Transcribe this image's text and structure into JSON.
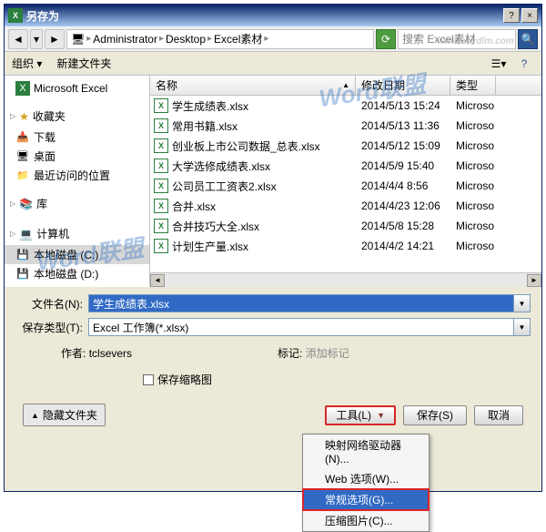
{
  "title": "另存为",
  "breadcrumb": [
    "Administrator",
    "Desktop",
    "Excel素材"
  ],
  "search_placeholder": "搜索 Excel素材",
  "toolbar": {
    "org": "组织",
    "newf": "新建文件夹"
  },
  "sidebar": {
    "top": "Microsoft Excel",
    "fav": "收藏夹",
    "fav_items": [
      "下载",
      "桌面",
      "最近访问的位置"
    ],
    "lib": "库",
    "cmp": "计算机",
    "drives": [
      "本地磁盘 (C:)",
      "本地磁盘 (D:)"
    ]
  },
  "headers": {
    "name": "名称",
    "date": "修改日期",
    "type": "类型"
  },
  "files": [
    {
      "n": "学生成绩表.xlsx",
      "d": "2014/5/13 15:24",
      "t": "Microso"
    },
    {
      "n": "常用书籍.xlsx",
      "d": "2014/5/13 11:36",
      "t": "Microso"
    },
    {
      "n": "创业板上市公司数据_总表.xlsx",
      "d": "2014/5/12 15:09",
      "t": "Microso"
    },
    {
      "n": "大学选修成绩表.xlsx",
      "d": "2014/5/9 15:40",
      "t": "Microso"
    },
    {
      "n": "公司员工工资表2.xlsx",
      "d": "2014/4/4 8:56",
      "t": "Microso"
    },
    {
      "n": "合并.xlsx",
      "d": "2014/4/23 12:06",
      "t": "Microso"
    },
    {
      "n": "合并技巧大全.xlsx",
      "d": "2014/5/8 15:28",
      "t": "Microso"
    },
    {
      "n": "计划生产量.xlsx",
      "d": "2014/4/2 14:21",
      "t": "Microso"
    }
  ],
  "filename_lbl": "文件名(N):",
  "filename_val": "学生成绩表.xlsx",
  "type_lbl": "保存类型(T):",
  "type_val": "Excel 工作簿(*.xlsx)",
  "author_lbl": "作者:",
  "author_val": "tclsevers",
  "tag_lbl": "标记:",
  "tag_val": "添加标记",
  "thumb": "保存缩略图",
  "hide": "隐藏文件夹",
  "tools": "工具(L)",
  "save": "保存(S)",
  "cancel": "取消",
  "menu": [
    "映射网络驱动器(N)...",
    "Web 选项(W)...",
    "常规选项(G)...",
    "压缩图片(C)..."
  ]
}
